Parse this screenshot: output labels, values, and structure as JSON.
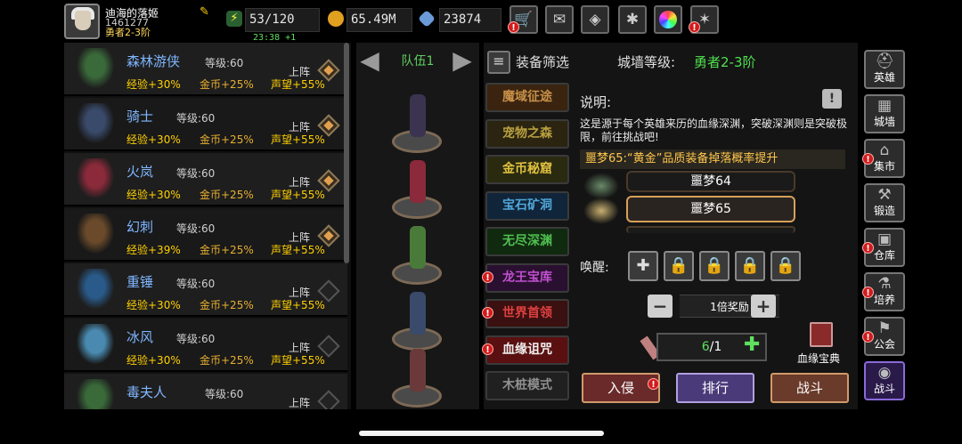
{
  "player": {
    "name": "迪海的落姬",
    "id": "1461277",
    "rank": "勇者2-3阶"
  },
  "resources": {
    "stamina": "53/120",
    "stamina_timer": "23:38 +1",
    "gold": "65.49M",
    "gems": "23874"
  },
  "toolbar_icons": [
    "cart-icon",
    "mail-icon",
    "gamepad-icon",
    "gear-icon",
    "color-wheel-icon",
    "crack-icon"
  ],
  "heroes": [
    {
      "name": "森林游侠",
      "level_label": "等级:60",
      "exp": "经验+30%",
      "gold": "金币+25%",
      "fame": "声望+55%",
      "action": "上阵",
      "active": true
    },
    {
      "name": "骑士",
      "level_label": "等级:60",
      "exp": "经验+30%",
      "gold": "金币+25%",
      "fame": "声望+55%",
      "action": "上阵",
      "active": true
    },
    {
      "name": "火岚",
      "level_label": "等级:60",
      "exp": "经验+30%",
      "gold": "金币+25%",
      "fame": "声望+55%",
      "action": "上阵",
      "active": true
    },
    {
      "name": "幻刺",
      "level_label": "等级:60",
      "exp": "经验+39%",
      "gold": "金币+25%",
      "fame": "声望+55%",
      "action": "上阵",
      "active": true
    },
    {
      "name": "重锤",
      "level_label": "等级:60",
      "exp": "经验+30%",
      "gold": "金币+25%",
      "fame": "声望+55%",
      "action": "上阵",
      "active": false
    },
    {
      "name": "冰风",
      "level_label": "等级:60",
      "exp": "经验+30%",
      "gold": "金币+25%",
      "fame": "声望+55%",
      "action": "上阵",
      "active": false
    },
    {
      "name": "毒夫人",
      "level_label": "等级:60",
      "exp": "",
      "gold": "",
      "fame": "",
      "action": "上阵",
      "active": false
    }
  ],
  "team": {
    "label": "队伍1"
  },
  "header": {
    "filter_label": "装备筛选",
    "wall_label": "城墙等级:",
    "wall_value": "勇者2-3阶"
  },
  "modes": [
    {
      "label": "魔域征途",
      "alert": false,
      "color": "#c89048",
      "bg": "#3a2410"
    },
    {
      "label": "宠物之森",
      "alert": false,
      "color": "#b8a040",
      "bg": "#2a2410"
    },
    {
      "label": "金币秘窟",
      "alert": false,
      "color": "#e0c040",
      "bg": "#2a2a10"
    },
    {
      "label": "宝石矿洞",
      "alert": false,
      "color": "#50a8d8",
      "bg": "#10243a"
    },
    {
      "label": "无尽深渊",
      "alert": false,
      "color": "#50c050",
      "bg": "#102a10"
    },
    {
      "label": "龙王宝库",
      "alert": true,
      "color": "#c050d0",
      "bg": "#2a1030"
    },
    {
      "label": "世界首领",
      "alert": true,
      "color": "#e04040",
      "bg": "#3a1010"
    },
    {
      "label": "血缘诅咒",
      "alert": true,
      "color": "#f0f0f0",
      "bg": "#5a1010"
    },
    {
      "label": "木桩模式",
      "alert": false,
      "color": "#909090",
      "bg": "#202020"
    }
  ],
  "description": {
    "title": "说明:",
    "text": "这是源于每个英雄来历的血缘深渊，突破深渊则是突破极限，前往挑战吧!",
    "bonus": "噩梦65:“黄金”品质装备掉落概率提升"
  },
  "difficulty": {
    "prev": "噩梦64",
    "current": "噩梦65"
  },
  "awaken": {
    "label": "唤醒:"
  },
  "multiplier": {
    "label": "1倍奖励"
  },
  "keys": {
    "current": "6",
    "max": "/1"
  },
  "book": {
    "label": "血缘宝典"
  },
  "actions": {
    "invade": "入侵",
    "rank": "排行",
    "battle": "战斗"
  },
  "sidebar": [
    {
      "label": "英雄",
      "icon": "helmet-icon",
      "alert": false
    },
    {
      "label": "城墙",
      "icon": "wall-icon",
      "alert": false
    },
    {
      "label": "集市",
      "icon": "market-icon",
      "alert": true
    },
    {
      "label": "锻造",
      "icon": "anvil-icon",
      "alert": false
    },
    {
      "label": "仓库",
      "icon": "chest-icon",
      "alert": true
    },
    {
      "label": "培养",
      "icon": "potion-icon",
      "alert": true
    },
    {
      "label": "公会",
      "icon": "guild-icon",
      "alert": true
    },
    {
      "label": "战斗",
      "icon": "portal-icon",
      "alert": false
    }
  ],
  "colors": {
    "accent_green": "#4fe04f",
    "gold": "#ffd000",
    "alert": "#d21b1b"
  }
}
